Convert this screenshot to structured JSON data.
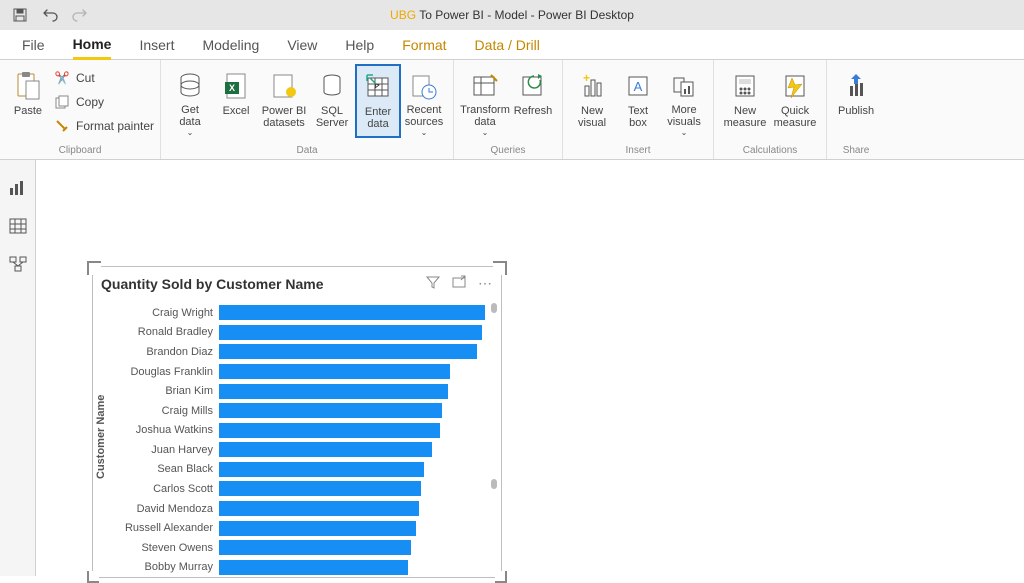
{
  "title": {
    "prefix_highlight": "UBG",
    "rest": " To Power BI - Model - Power BI Desktop"
  },
  "menu": {
    "file": "File",
    "home": "Home",
    "insert": "Insert",
    "modeling": "Modeling",
    "view": "View",
    "help": "Help",
    "format": "Format",
    "data_drill": "Data / Drill"
  },
  "ribbon": {
    "clipboard": {
      "group": "Clipboard",
      "paste": "Paste",
      "cut": "Cut",
      "copy": "Copy",
      "format_painter": "Format painter"
    },
    "data": {
      "group": "Data",
      "get_data": "Get\ndata",
      "excel": "Excel",
      "pbi_datasets": "Power BI\ndatasets",
      "sql_server": "SQL\nServer",
      "enter_data": "Enter\ndata",
      "recent_sources": "Recent\nsources"
    },
    "queries": {
      "group": "Queries",
      "transform": "Transform\ndata",
      "refresh": "Refresh"
    },
    "insert": {
      "group": "Insert",
      "new_visual": "New\nvisual",
      "text_box": "Text\nbox",
      "more_visuals": "More\nvisuals"
    },
    "calc": {
      "group": "Calculations",
      "new_measure": "New\nmeasure",
      "quick_measure": "Quick\nmeasure"
    },
    "share": {
      "group": "Share",
      "publish": "Publish"
    }
  },
  "chart_data": {
    "type": "bar",
    "title": "Quantity Sold by Customer Name",
    "ylabel": "Customer Name",
    "xlabel": "",
    "categories": [
      "Craig Wright",
      "Ronald Bradley",
      "Brandon Diaz",
      "Douglas Franklin",
      "Brian Kim",
      "Craig Mills",
      "Joshua Watkins",
      "Juan Harvey",
      "Sean Black",
      "Carlos Scott",
      "David Mendoza",
      "Russell Alexander",
      "Steven Owens",
      "Bobby Murray"
    ],
    "values": [
      100,
      99,
      97,
      87,
      86,
      84,
      83,
      80,
      77,
      76,
      75,
      74,
      72,
      71
    ],
    "xlim": [
      0,
      100
    ],
    "color": "#168ef4"
  }
}
